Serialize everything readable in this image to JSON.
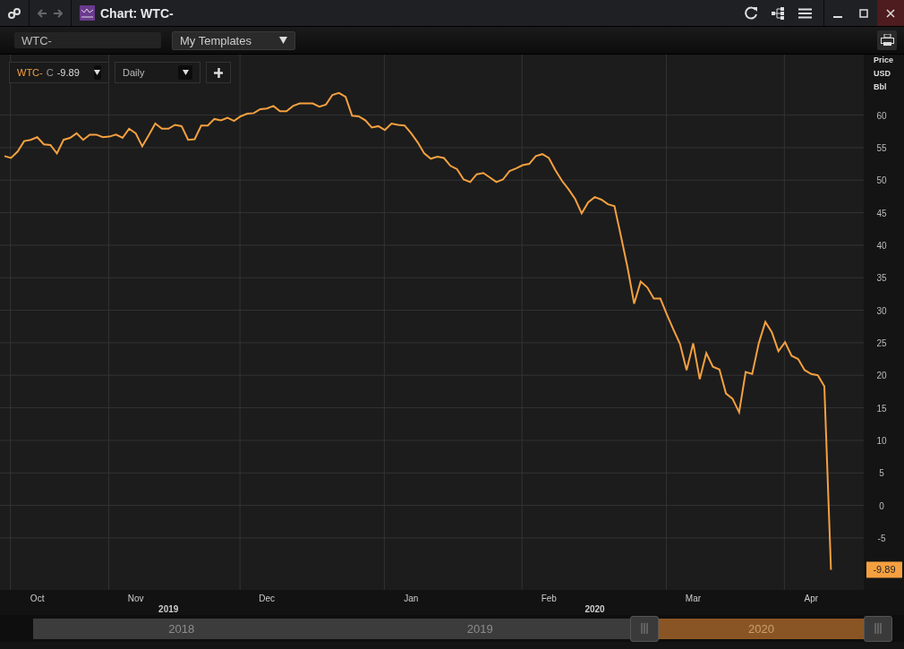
{
  "window": {
    "title": "Chart: WTC-"
  },
  "toolbar": {
    "symbol_field": {
      "value": "WTC-"
    },
    "template_dropdown": {
      "label": "My Templates"
    }
  },
  "legend": {
    "field": "C",
    "value": "-9.89"
  },
  "interval": {
    "label": "Daily"
  },
  "axis_units": [
    "Price",
    "USD",
    "Bbl"
  ],
  "last_value_label": "-9.89",
  "chart_data": {
    "type": "line",
    "grid": true,
    "ylim": [
      -13,
      69.3
    ],
    "categories": [
      null,
      null,
      null,
      null,
      null,
      "Oct",
      null,
      null,
      null,
      null,
      null,
      null,
      null,
      null,
      null,
      null,
      null,
      null,
      null,
      null,
      "Nov",
      null,
      null,
      null,
      null,
      null,
      null,
      null,
      null,
      null,
      null,
      null,
      null,
      null,
      null,
      null,
      null,
      null,
      null,
      null,
      "Dec",
      null,
      null,
      null,
      null,
      null,
      null,
      null,
      null,
      null,
      null,
      null,
      null,
      null,
      null,
      null,
      null,
      null,
      null,
      null,
      null,
      null,
      "Jan",
      null,
      null,
      null,
      null,
      null,
      null,
      null,
      null,
      null,
      null,
      null,
      null,
      null,
      null,
      null,
      null,
      null,
      null,
      null,
      null,
      "Feb",
      null,
      null,
      null,
      null,
      null,
      null,
      null,
      null,
      null,
      null,
      null,
      null,
      null,
      null,
      null,
      null,
      null,
      null,
      null,
      null,
      null,
      "Mar",
      null,
      null,
      null,
      null,
      null,
      null,
      null,
      null,
      null,
      null,
      null,
      null,
      null,
      null,
      null,
      null,
      null,
      "Apr",
      null,
      null,
      null
    ],
    "yticks": [
      -5,
      0,
      5,
      10,
      15,
      20,
      25,
      30,
      35,
      40,
      45,
      50,
      55,
      60
    ],
    "series": [
      {
        "name": "WTC-",
        "color": "#f5a040",
        "values": [
          53.7,
          53.4,
          54.4,
          56,
          56.2,
          56.6,
          55.5,
          55.4,
          54.1,
          56.2,
          56.5,
          57.2,
          56.2,
          57,
          57,
          56.6,
          56.7,
          57,
          56.5,
          57.9,
          57.2,
          55.2,
          56.9,
          58.7,
          57.9,
          57.9,
          58.5,
          58.3,
          56.2,
          56.3,
          58.4,
          58.4,
          59.4,
          59.2,
          59.6,
          59.1,
          59.8,
          60.2,
          60.3,
          60.9,
          61,
          61.4,
          60.6,
          60.6,
          61.4,
          61.8,
          61.8,
          61.8,
          61.3,
          61.6,
          63.1,
          63.4,
          62.8,
          59.9,
          59.8,
          59.2,
          58.1,
          58.3,
          57.7,
          58.7,
          58.5,
          58.4,
          57.2,
          55.8,
          54.1,
          53.3,
          53.6,
          53.4,
          52.2,
          51.7,
          50.1,
          49.7,
          50.9,
          51.1,
          50.4,
          49.7,
          50.1,
          51.4,
          51.8,
          52.3,
          52.5,
          53.7,
          54,
          53.4,
          51.5,
          49.9,
          48.6,
          47.1,
          44.9,
          46.6,
          47.4,
          47,
          46.3,
          46,
          41.3,
          36.5,
          31,
          34.4,
          33.5,
          31.8,
          31.8,
          29.3,
          27,
          24.8,
          20.8,
          24.9,
          19.4,
          23.4,
          21.3,
          20.9,
          17.2,
          16.4,
          14.3,
          20.5,
          20.2,
          24.9,
          28.2,
          26.6,
          23.7,
          25.1,
          23,
          22.5,
          20.8,
          20.2,
          20,
          18.3,
          -9.9
        ]
      }
    ]
  },
  "year_labels": [
    {
      "label": "2019"
    },
    {
      "label": "2020"
    }
  ],
  "navigator": {
    "segments": [
      {
        "label": "2018",
        "selected": false
      },
      {
        "label": "2019",
        "selected": false
      },
      {
        "label": "2020",
        "selected": true
      }
    ]
  }
}
